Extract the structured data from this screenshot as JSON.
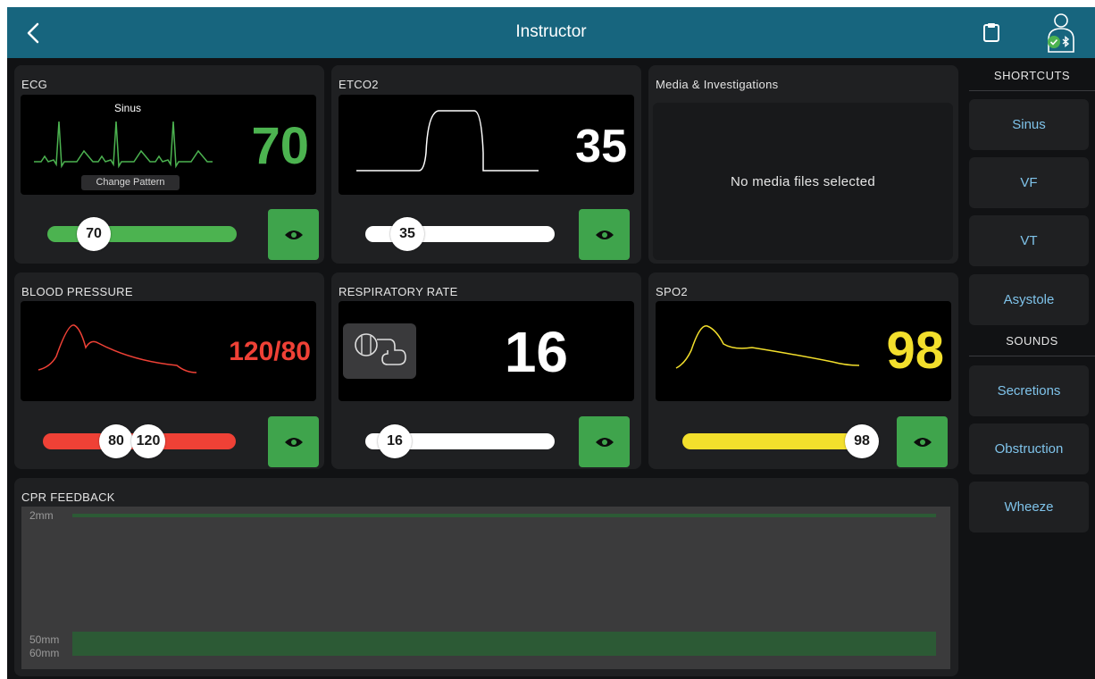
{
  "header": {
    "title": "Instructor"
  },
  "ecg": {
    "label": "ECG",
    "rhythm": "Sinus",
    "change_pattern": "Change Pattern",
    "value": "70",
    "slider_value": "70",
    "slider_fraction": 0.15,
    "color": "#4cb350"
  },
  "etco2": {
    "label": "ETCO2",
    "value": "35",
    "slider_value": "35",
    "slider_fraction": 0.15,
    "color": "#ffffff"
  },
  "media": {
    "label": "Media & Investigations",
    "empty_text": "No media files selected"
  },
  "bp": {
    "label": "BLOOD PRESSURE",
    "value": "120/80",
    "slider_low": "80",
    "slider_high": "120",
    "color": "#ef4136"
  },
  "resp": {
    "label": "RESPIRATORY RATE",
    "value": "16",
    "slider_value": "16",
    "slider_fraction": 0.1,
    "color": "#ffffff"
  },
  "spo2": {
    "label": "SPO2",
    "value": "98",
    "slider_value": "98",
    "slider_fraction": 0.98,
    "color": "#f3df2c"
  },
  "cpr": {
    "label": "CPR FEEDBACK",
    "depth_top": "2mm",
    "depth_mid": "50mm",
    "depth_bottom": "60mm"
  },
  "sidebar": {
    "shortcuts_title": "SHORTCUTS",
    "shortcuts": [
      "Sinus",
      "VF",
      "VT",
      "Asystole"
    ],
    "sounds_title": "SOUNDS",
    "sounds": [
      "Secretions",
      "Obstruction",
      "Wheeze"
    ]
  },
  "colors": {
    "accent": "#17657e",
    "button_green": "#3fa44c",
    "shortcut_text": "#7fc3ea"
  }
}
